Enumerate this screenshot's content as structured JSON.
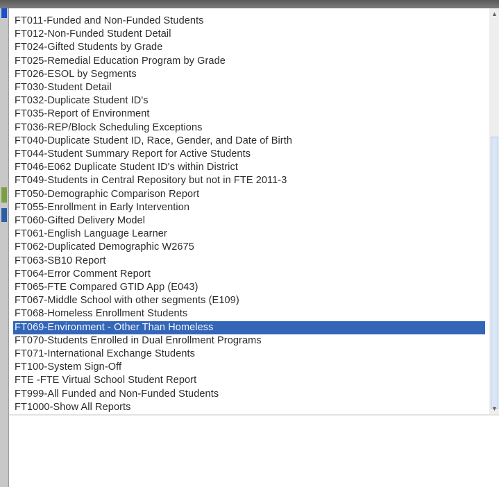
{
  "dropdown": {
    "items": [
      "FT011-Funded and Non-Funded Students",
      "FT012-Non-Funded Student Detail",
      "FT024-Gifted Students by Grade",
      "FT025-Remedial Education Program by Grade",
      "FT026-ESOL by Segments",
      "FT030-Student Detail",
      "FT032-Duplicate Student ID's",
      "FT035-Report of Environment",
      "FT036-REP/Block Scheduling Exceptions",
      "FT040-Duplicate Student ID, Race, Gender, and Date of Birth",
      "FT044-Student Summary Report for Active Students",
      "FT046-E062 Duplicate Student ID's within District",
      "FT049-Students in Central Repository but not in FTE 2011-3",
      "FT050-Demographic Comparison Report",
      "FT055-Enrollment in Early Intervention",
      "FT060-Gifted Delivery Model",
      "FT061-English Language Learner",
      "FT062-Duplicated Demographic W2675",
      "FT063-SB10 Report",
      "FT064-Error Comment Report",
      "FT065-FTE Compared GTID App (E043)",
      "FT067-Middle School with other segments (E109)",
      "FT068-Homeless Enrollment Students",
      "FT069-Environment - Other Than Homeless",
      "FT070-Students Enrolled in Dual Enrollment Programs",
      "FT071-International Exchange Students",
      "FT100-System Sign-Off",
      "FTE -FTE Virtual School Student Report",
      "FT999-All Funded and Non-Funded Students",
      "FT1000-Show All Reports"
    ],
    "selected_index": 23
  },
  "scrollbar": {
    "up_arrow_icon": "scroll-up-arrow-icon",
    "down_arrow_icon": "scroll-down-arrow-icon"
  },
  "colors": {
    "selection": "#3466b8",
    "left_strip_marks": [
      "#1a4fd0",
      "#7aa040",
      "#2a5fa8"
    ]
  }
}
